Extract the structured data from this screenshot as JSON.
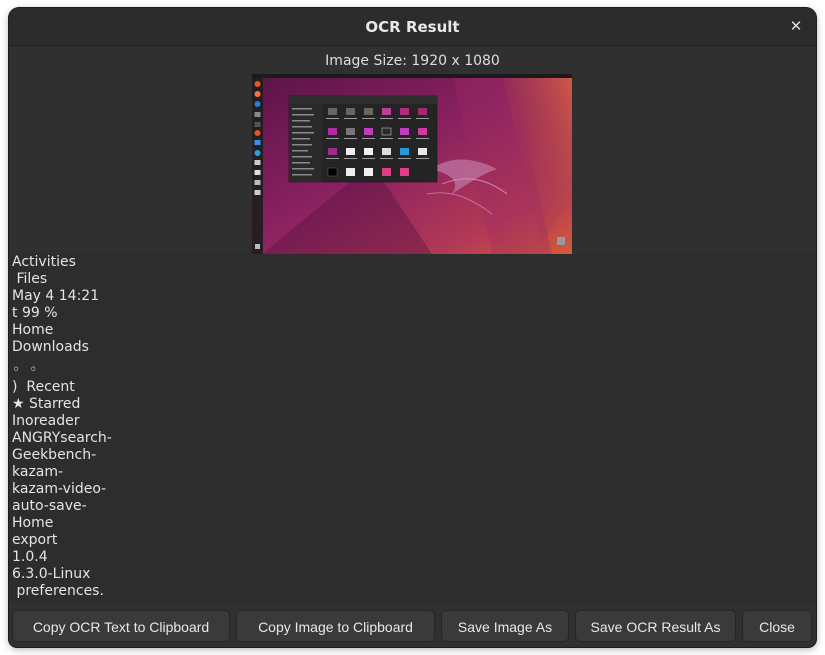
{
  "dialog": {
    "title": "OCR Result",
    "close_glyph": "✕"
  },
  "image_info": {
    "size_text": "Image Size: 1920 x 1080"
  },
  "ocr_lines": [
    "Activities",
    " Files",
    "May 4 14:21",
    "t 99 %",
    "Home",
    "Downloads",
    "",
    "◦  ◦",
    ")  Recent",
    "★ Starred",
    "Inoreader",
    "ANGRYsearch-",
    "Geekbench-",
    "kazam-",
    "kazam-video-",
    "auto-save-",
    "Home",
    "export",
    "1.0.4",
    "6.3.0-Linux",
    " preferences."
  ],
  "buttons": {
    "copy_text": "Copy OCR Text to Clipboard",
    "copy_image": "Copy Image to Clipboard",
    "save_image": "Save Image As",
    "save_result": "Save OCR Result As",
    "close": "Close"
  },
  "colors": {
    "window_bg": "#303030",
    "text_bg": "#2d2d2d",
    "wallpaper_purple": "#7a1e57",
    "wallpaper_orange": "#d45a3a"
  },
  "icons": [
    "close-icon"
  ]
}
